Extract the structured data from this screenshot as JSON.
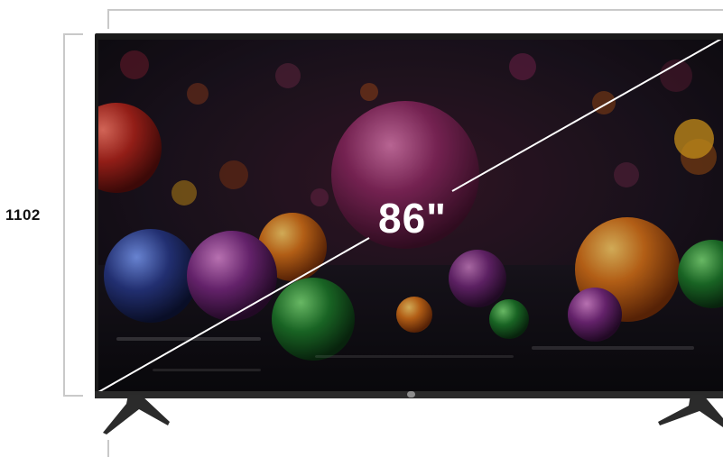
{
  "dimensions": {
    "height_label": "1102",
    "diagonal_label": "86\""
  },
  "colors": {
    "bezel": "#1a1a1a",
    "dimension_line": "#c9c9c9",
    "label_text": "#111111",
    "diagonal_line": "#ffffff"
  },
  "icons": {
    "brand": "brand-logo-icon",
    "stand": "tv-stand-leg-icon"
  }
}
